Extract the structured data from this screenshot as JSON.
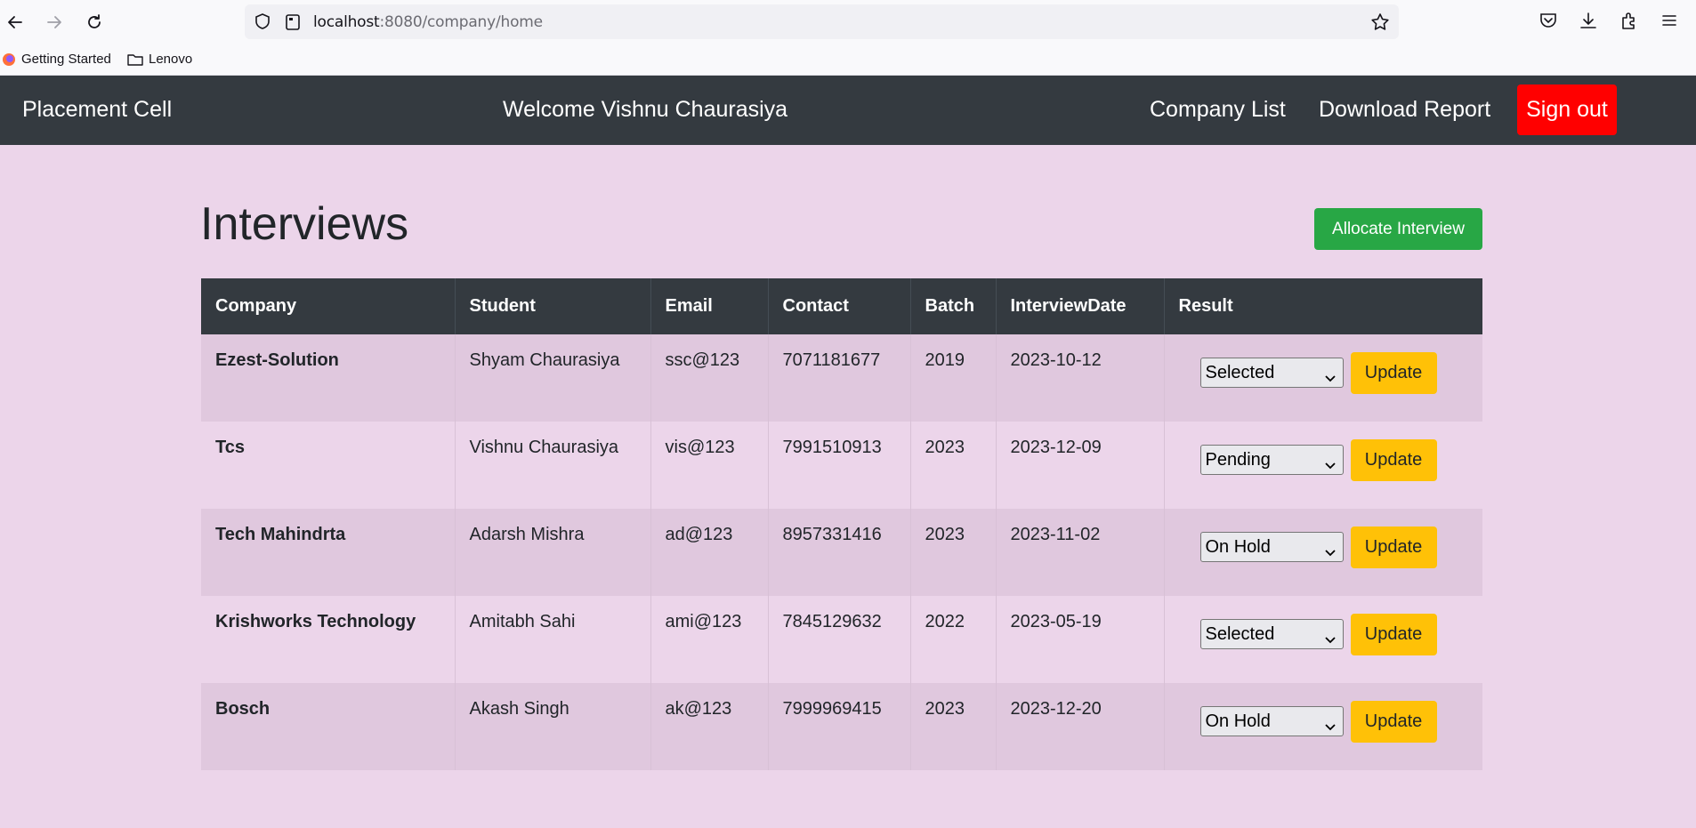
{
  "browser": {
    "url_host": "localhost",
    "url_rest": ":8080/company/home",
    "bookmarks": [
      {
        "label": "Getting Started"
      },
      {
        "label": "Lenovo"
      }
    ]
  },
  "navbar": {
    "brand": "Placement Cell",
    "welcome": "Welcome Vishnu Chaurasiya",
    "links": [
      "Company List",
      "Download Report"
    ],
    "signout": "Sign out"
  },
  "page": {
    "title": "Interviews",
    "allocate_button": "Allocate Interview"
  },
  "table": {
    "headers": [
      "Company",
      "Student",
      "Email",
      "Contact",
      "Batch",
      "InterviewDate",
      "Result"
    ],
    "rows": [
      {
        "company": "Ezest-Solution",
        "student": "Shyam Chaurasiya",
        "email": "ssc@123",
        "contact": "7071181677",
        "batch": "2019",
        "date": "2023-10-12",
        "result": "Selected",
        "update": "Update"
      },
      {
        "company": "Tcs",
        "student": "Vishnu Chaurasiya",
        "email": "vis@123",
        "contact": "7991510913",
        "batch": "2023",
        "date": "2023-12-09",
        "result": "Pending",
        "update": "Update"
      },
      {
        "company": "Tech Mahindrta",
        "student": "Adarsh Mishra",
        "email": "ad@123",
        "contact": "8957331416",
        "batch": "2023",
        "date": "2023-11-02",
        "result": "On Hold",
        "update": "Update"
      },
      {
        "company": "Krishworks Technology",
        "student": "Amitabh Sahi",
        "email": "ami@123",
        "contact": "7845129632",
        "batch": "2022",
        "date": "2023-05-19",
        "result": "Selected",
        "update": "Update"
      },
      {
        "company": "Bosch",
        "student": "Akash Singh",
        "email": "ak@123",
        "contact": "7999969415",
        "batch": "2023",
        "date": "2023-12-20",
        "result": "On Hold",
        "update": "Update"
      }
    ]
  },
  "colors": {
    "background": "#ecd5ea",
    "navbar": "#343a40",
    "signout": "#ff0000",
    "allocate": "#28a745",
    "update": "#ffc107"
  }
}
